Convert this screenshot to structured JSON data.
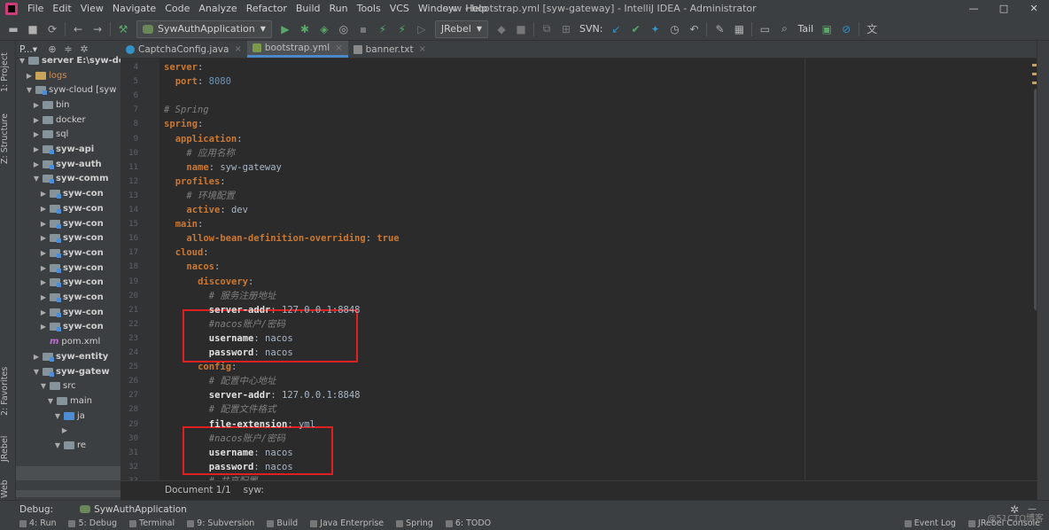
{
  "window": {
    "title": "syw - bootstrap.yml [syw-gateway] - IntelliJ IDEA - Administrator",
    "controls": [
      "—",
      "□",
      "✕"
    ]
  },
  "menu": [
    "File",
    "Edit",
    "View",
    "Navigate",
    "Code",
    "Analyze",
    "Refactor",
    "Build",
    "Run",
    "Tools",
    "VCS",
    "Window",
    "Help"
  ],
  "toolbar": {
    "run_config": "SywAuthApplication",
    "jrebel": "JRebel",
    "svn": "SVN:",
    "tail": "Tail"
  },
  "left_stripe": {
    "project": "1: Project",
    "structure": "Z: Structure",
    "favorites": "2: Favorites",
    "jrebel": "JRebel",
    "web": "Web"
  },
  "project_panel": {
    "title": "P...▾",
    "tree": [
      {
        "label": "server  E:\\syw-doc",
        "type": "folder",
        "bold": true,
        "expanded": true
      },
      {
        "label": "logs",
        "type": "folder-orange",
        "bold": false,
        "expanded": false
      },
      {
        "label": "syw-cloud [syw",
        "type": "module",
        "bold": false,
        "expanded": true
      },
      {
        "label": "bin",
        "type": "folder",
        "bold": false,
        "expanded": false
      },
      {
        "label": "docker",
        "type": "folder",
        "bold": false,
        "expanded": false
      },
      {
        "label": "sql",
        "type": "folder",
        "bold": false,
        "expanded": false
      },
      {
        "label": "syw-api",
        "type": "module",
        "bold": true,
        "expanded": false
      },
      {
        "label": "syw-auth",
        "type": "module",
        "bold": true,
        "expanded": false
      },
      {
        "label": "syw-comm",
        "type": "module",
        "bold": true,
        "expanded": true
      },
      {
        "label": "syw-con",
        "type": "module",
        "bold": true,
        "expanded": false
      },
      {
        "label": "syw-con",
        "type": "module",
        "bold": true,
        "expanded": false
      },
      {
        "label": "syw-con",
        "type": "module",
        "bold": true,
        "expanded": false
      },
      {
        "label": "syw-con",
        "type": "module",
        "bold": true,
        "expanded": false
      },
      {
        "label": "syw-con",
        "type": "module",
        "bold": true,
        "expanded": false
      },
      {
        "label": "syw-con",
        "type": "module",
        "bold": true,
        "expanded": false
      },
      {
        "label": "syw-con",
        "type": "module",
        "bold": true,
        "expanded": false
      },
      {
        "label": "syw-con",
        "type": "module",
        "bold": true,
        "expanded": false
      },
      {
        "label": "syw-con",
        "type": "module",
        "bold": true,
        "expanded": false
      },
      {
        "label": "syw-con",
        "type": "module",
        "bold": true,
        "expanded": false
      },
      {
        "label": "pom.xml",
        "type": "maven",
        "bold": false,
        "expanded": null
      },
      {
        "label": "syw-entity",
        "type": "module",
        "bold": true,
        "expanded": false
      },
      {
        "label": "syw-gatew",
        "type": "module",
        "bold": true,
        "expanded": true
      },
      {
        "label": "src",
        "type": "folder",
        "bold": false,
        "expanded": true
      },
      {
        "label": "main",
        "type": "folder",
        "bold": false,
        "expanded": true
      },
      {
        "label": "ja",
        "type": "folder-blue",
        "bold": false,
        "expanded": true
      },
      {
        "label": "",
        "type": "none",
        "bold": false,
        "expanded": false
      },
      {
        "label": "re",
        "type": "folder",
        "bold": false,
        "expanded": true
      }
    ]
  },
  "tabs": [
    {
      "label": "CaptchaConfig.java",
      "icon": "java",
      "active": false
    },
    {
      "label": "bootstrap.yml",
      "icon": "yml",
      "active": true
    },
    {
      "label": "banner.txt",
      "icon": "txt",
      "active": false
    }
  ],
  "editor": {
    "line_numbers": [
      "4",
      "5",
      "6",
      "7",
      "8",
      "9",
      "10",
      "11",
      "12",
      "13",
      "14",
      "15",
      "16",
      "17",
      "18",
      "19",
      "20",
      "21",
      "22",
      "23",
      "24",
      "25",
      "26",
      "27",
      "28",
      "29",
      "30",
      "31",
      "32",
      "33"
    ],
    "lines": [
      {
        "indent": 0,
        "key": "server",
        "sep": ":",
        "value": "",
        "vtype": "",
        "comment": ""
      },
      {
        "indent": 2,
        "key": "port",
        "sep": ": ",
        "value": "8080",
        "vtype": "num",
        "comment": ""
      },
      {
        "indent": 0,
        "key": "",
        "sep": "",
        "value": "",
        "vtype": "",
        "comment": ""
      },
      {
        "indent": 0,
        "key": "",
        "sep": "",
        "value": "",
        "vtype": "",
        "comment": "# Spring"
      },
      {
        "indent": 0,
        "key": "spring",
        "sep": ":",
        "value": "",
        "vtype": "",
        "comment": ""
      },
      {
        "indent": 2,
        "key": "application",
        "sep": ":",
        "value": "",
        "vtype": "",
        "comment": ""
      },
      {
        "indent": 4,
        "key": "",
        "sep": "",
        "value": "",
        "vtype": "",
        "comment": "# 应用名称"
      },
      {
        "indent": 4,
        "key": "name",
        "sep": ": ",
        "value": "syw-gateway",
        "vtype": "v",
        "comment": ""
      },
      {
        "indent": 2,
        "key": "profiles",
        "sep": ":",
        "value": "",
        "vtype": "",
        "comment": ""
      },
      {
        "indent": 4,
        "key": "",
        "sep": "",
        "value": "",
        "vtype": "",
        "comment": "# 环境配置"
      },
      {
        "indent": 4,
        "key": "active",
        "sep": ": ",
        "value": "dev",
        "vtype": "v",
        "comment": ""
      },
      {
        "indent": 2,
        "key": "main",
        "sep": ":",
        "value": "",
        "vtype": "",
        "comment": ""
      },
      {
        "indent": 4,
        "key": "allow-bean-definition-overriding",
        "sep": ": ",
        "value": "true",
        "vtype": "kw",
        "comment": ""
      },
      {
        "indent": 2,
        "key": "cloud",
        "sep": ":",
        "value": "",
        "vtype": "",
        "comment": ""
      },
      {
        "indent": 4,
        "key": "nacos",
        "sep": ":",
        "value": "",
        "vtype": "",
        "comment": ""
      },
      {
        "indent": 6,
        "key": "discovery",
        "sep": ":",
        "value": "",
        "vtype": "",
        "comment": ""
      },
      {
        "indent": 8,
        "key": "",
        "sep": "",
        "value": "",
        "vtype": "",
        "comment": "# 服务注册地址"
      },
      {
        "indent": 8,
        "key": "server-addr",
        "sep": ": ",
        "value": "127.0.0.1:8848",
        "vtype": "v",
        "comment": ""
      },
      {
        "indent": 8,
        "key": "",
        "sep": "",
        "value": "",
        "vtype": "",
        "comment": "#nacos账户/密码"
      },
      {
        "indent": 8,
        "key": "username",
        "sep": ": ",
        "value": "nacos",
        "vtype": "v",
        "comment": ""
      },
      {
        "indent": 8,
        "key": "password",
        "sep": ": ",
        "value": "nacos",
        "vtype": "v",
        "comment": ""
      },
      {
        "indent": 6,
        "key": "config",
        "sep": ":",
        "value": "",
        "vtype": "",
        "comment": ""
      },
      {
        "indent": 8,
        "key": "",
        "sep": "",
        "value": "",
        "vtype": "",
        "comment": "# 配置中心地址"
      },
      {
        "indent": 8,
        "key": "server-addr",
        "sep": ": ",
        "value": "127.0.0.1:8848",
        "vtype": "v",
        "comment": ""
      },
      {
        "indent": 8,
        "key": "",
        "sep": "",
        "value": "",
        "vtype": "",
        "comment": "# 配置文件格式"
      },
      {
        "indent": 8,
        "key": "file-extension",
        "sep": ": ",
        "value": "yml",
        "vtype": "v",
        "comment": ""
      },
      {
        "indent": 8,
        "key": "",
        "sep": "",
        "value": "",
        "vtype": "",
        "comment": "#nacos账户/密码"
      },
      {
        "indent": 8,
        "key": "username",
        "sep": ": ",
        "value": "nacos",
        "vtype": "v",
        "comment": ""
      },
      {
        "indent": 8,
        "key": "password",
        "sep": ": ",
        "value": "nacos",
        "vtype": "v",
        "comment": ""
      },
      {
        "indent": 8,
        "key": "",
        "sep": "",
        "value": "",
        "vtype": "",
        "comment": "# 共享配置"
      }
    ]
  },
  "breadcrumb": {
    "document": "Document 1/1",
    "path": "syw:"
  },
  "debug_bar": {
    "label": "Debug:",
    "session": "SywAuthApplication"
  },
  "bottom_tabs": [
    "4: Run",
    "5: Debug",
    "Terminal",
    "9: Subversion",
    "Build",
    "Java Enterprise",
    "Spring",
    "6: TODO"
  ],
  "bottom_right_tabs": [
    "Event Log",
    "JRebel Console"
  ],
  "watermark": "@51CTO博客",
  "colors": {
    "highlight_box": "#e02020",
    "yaml_key": "#cc7832",
    "comment": "#808080",
    "number": "#6897bb"
  }
}
